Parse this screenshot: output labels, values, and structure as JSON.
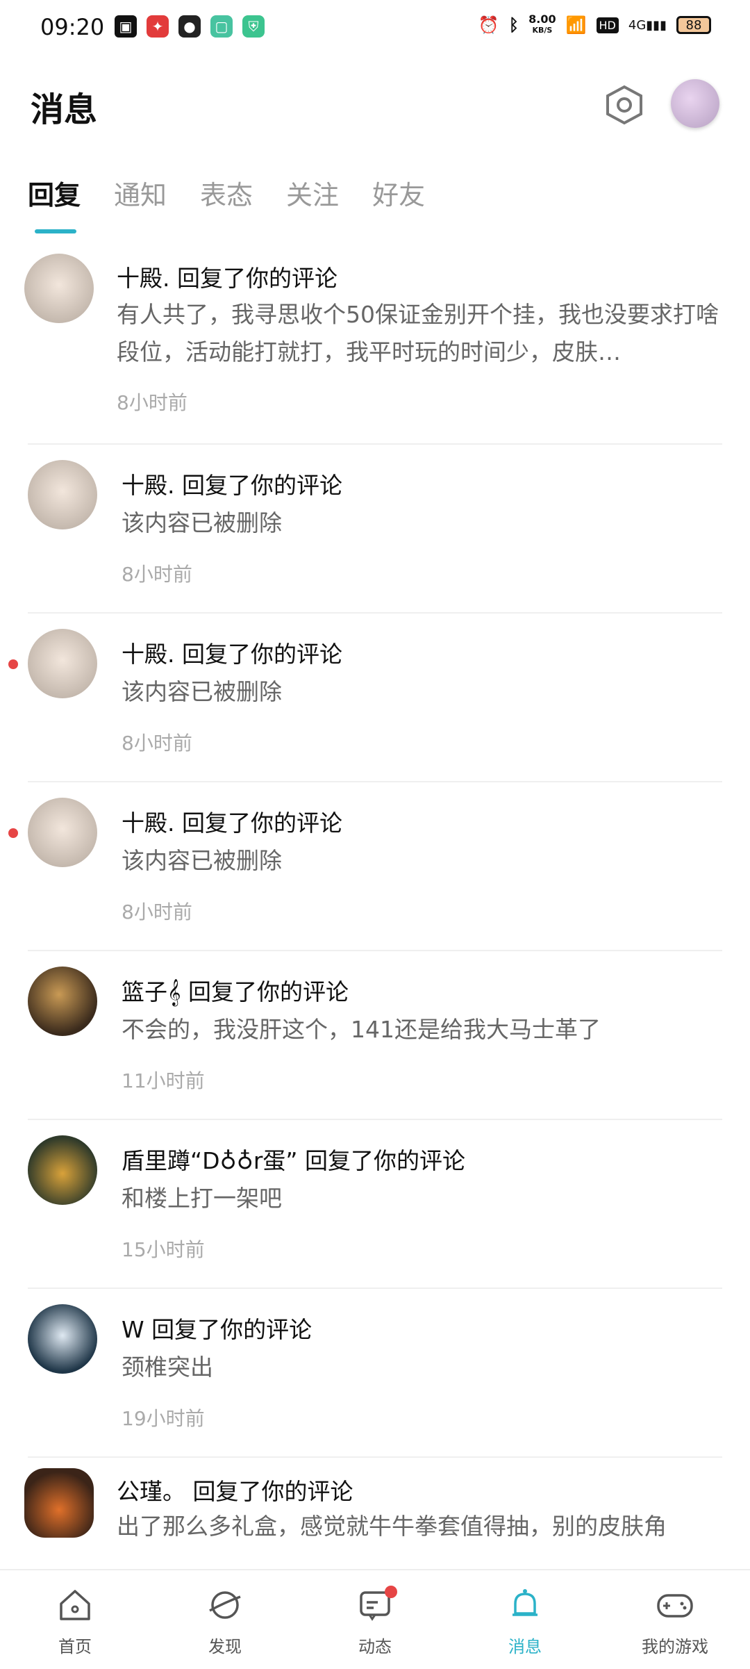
{
  "status_bar": {
    "time": "09:20",
    "speed_value": "8.00",
    "speed_unit": "KB/S",
    "network": "4G",
    "hd": "HD",
    "battery": "88"
  },
  "header": {
    "title": "消息"
  },
  "tabs": [
    {
      "label": "回复",
      "active": true
    },
    {
      "label": "通知"
    },
    {
      "label": "表态"
    },
    {
      "label": "关注"
    },
    {
      "label": "好友"
    }
  ],
  "messages": [
    {
      "name": "十殿. 回复了你的评论",
      "content": "有人共了，我寻思收个50保证金别开个挂，我也没要求打啥段位，活动能打就打，我平时玩的时间少，皮肤…",
      "time": "8小时前",
      "unread": false
    },
    {
      "name": "十殿. 回复了你的评论",
      "content": "该内容已被删除",
      "time": "8小时前",
      "unread": false
    },
    {
      "name": "十殿. 回复了你的评论",
      "content": "该内容已被删除",
      "time": "8小时前",
      "unread": true
    },
    {
      "name": "十殿. 回复了你的评论",
      "content": "该内容已被删除",
      "time": "8小时前",
      "unread": true
    },
    {
      "name": "篮子𝄞 回复了你的评论",
      "content": "不会的，我没肝这个，141还是给我大马士革了",
      "time": "11小时前",
      "unread": false
    },
    {
      "name": "盾里蹲“D♁♁r蛋” 回复了你的评论",
      "content": "和楼上打一架吧",
      "time": "15小时前",
      "unread": false
    },
    {
      "name": "W 回复了你的评论",
      "content": "颈椎突出",
      "time": "19小时前",
      "unread": false
    },
    {
      "name": "公瑾。 回复了你的评论",
      "content": "出了那么多礼盒，感觉就牛牛拳套值得抽，别的皮肤角",
      "time": "",
      "unread": false
    }
  ],
  "bottom_nav": [
    {
      "label": "首页",
      "icon": "home-icon"
    },
    {
      "label": "发现",
      "icon": "discover-icon"
    },
    {
      "label": "动态",
      "icon": "feed-icon",
      "badge": true
    },
    {
      "label": "消息",
      "icon": "bell-icon",
      "active": true
    },
    {
      "label": "我的游戏",
      "icon": "gamepad-icon"
    }
  ],
  "colors": {
    "accent": "#2bb2c8",
    "unread_dot": "#e64545"
  }
}
